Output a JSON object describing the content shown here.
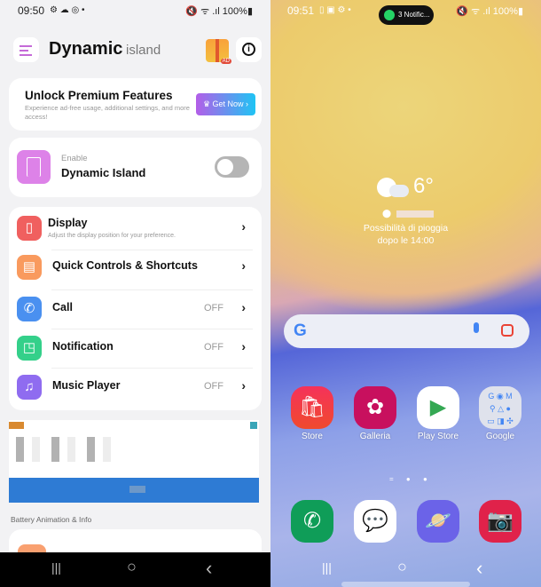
{
  "left": {
    "status": {
      "time": "09:50",
      "icons": "⚙ ☁ ◎ •",
      "right": "🔇 ᯤ .ıl 100%▮"
    },
    "header": {
      "title": "Dynamic",
      "subtitle": "island",
      "menu_icon": "menu-icon",
      "gift_icon": "gift-icon",
      "gift_badge": "AD",
      "info_icon": "info-icon"
    },
    "premium": {
      "title": "Unlock Premium Features",
      "desc": "Experience ad-free usage, additional settings, and more access!",
      "button": "Get Now ›"
    },
    "enable": {
      "label": "Enable",
      "title": "Dynamic Island",
      "on": false
    },
    "items": [
      {
        "label": "Display",
        "desc": "Adjust the display position for your preference.",
        "status": "",
        "color": "#f0605f",
        "icon": "▯"
      },
      {
        "label": "Quick Controls & Shortcuts",
        "status": "",
        "color": "#f99a5e",
        "icon": "▤"
      },
      {
        "label": "Call",
        "status": "OFF",
        "color": "#4a90f0",
        "icon": "✆"
      },
      {
        "label": "Notification",
        "status": "OFF",
        "color": "#34d08a",
        "icon": "◳"
      },
      {
        "label": "Music Player",
        "status": "OFF",
        "color": "#8f6cf0",
        "icon": "♫"
      }
    ],
    "section": "Battery Animation & Info",
    "colors": {
      "accent": "#e07be0",
      "ad_blue": "#2e7bd4"
    }
  },
  "right": {
    "status": {
      "time": "09:51",
      "icons": "▯ ▣ ⚙ •",
      "right": "🔇 ᯤ .ıl 100%▮"
    },
    "island": {
      "text": "3 Notific..."
    },
    "weather": {
      "temp": "6°",
      "line1": "Possibilità di pioggia",
      "line2": "dopo le 14:00"
    },
    "apps": [
      {
        "label": "Store"
      },
      {
        "label": "Galleria"
      },
      {
        "label": "Play Store"
      },
      {
        "label": "Google"
      }
    ],
    "dock": [
      "phone",
      "messages",
      "internet",
      "camera"
    ]
  },
  "nav": {
    "recents": "|||",
    "home": "○",
    "back": "‹"
  }
}
